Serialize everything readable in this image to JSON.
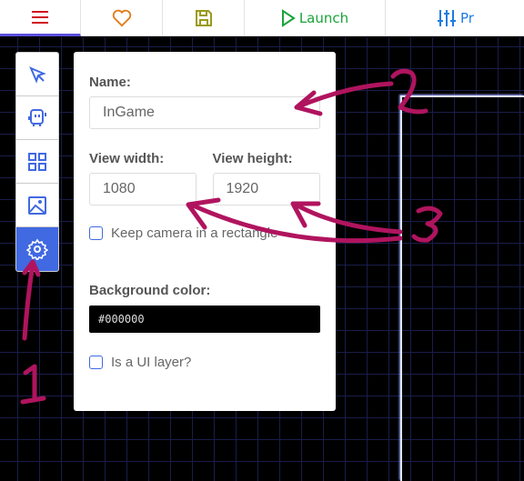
{
  "topbar": {
    "launch": "Launch",
    "project": "Pr"
  },
  "panel": {
    "name_label": "Name:",
    "name_value": "InGame",
    "width_label": "View width:",
    "width_value": "1080",
    "height_label": "View height:",
    "height_value": "1920",
    "keep_camera_label": "Keep camera in a rectangle",
    "bg_label": "Background color:",
    "bg_value": "#000000",
    "ui_layer_label": "Is a UI layer?"
  },
  "annotations": {
    "one": "1",
    "two": "2",
    "three": "3"
  },
  "colors": {
    "accent": "#4169e1",
    "annotation": "#b0145e"
  }
}
